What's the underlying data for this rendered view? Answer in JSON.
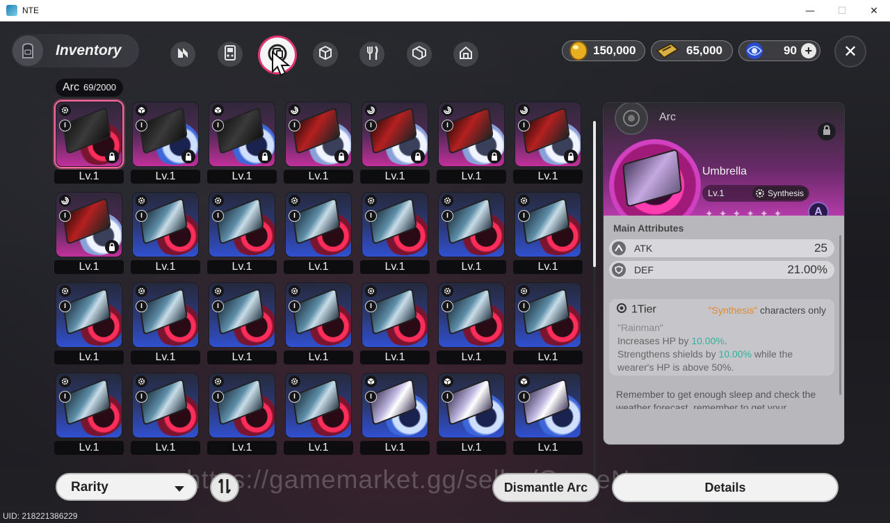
{
  "window": {
    "title": "NTE",
    "minimize_glyph": "—",
    "maximize_glyph": "☐",
    "close_glyph": "✕"
  },
  "header": {
    "title": "Inventory",
    "close_glyph": "✕",
    "categories": [
      {
        "icon": "n-logo-icon"
      },
      {
        "icon": "gameboy-icon"
      },
      {
        "icon": "arc-disc-icon",
        "active": true
      },
      {
        "icon": "cube-icon"
      },
      {
        "icon": "fork-knife-icon"
      },
      {
        "icon": "package-icon"
      },
      {
        "icon": "home-icon"
      }
    ],
    "currencies": [
      {
        "icon": "gold-egg-icon",
        "value": "150,000"
      },
      {
        "icon": "ticket-icon",
        "value": "65,000"
      },
      {
        "icon": "blue-orb-icon",
        "value": "90",
        "add_glyph": "+"
      }
    ]
  },
  "arc_count": {
    "label": "Arc",
    "count": "69/2000"
  },
  "grid": {
    "items": [
      {
        "type": "gear",
        "tier": "I",
        "color": "pink",
        "ring": "red",
        "disc": "dark",
        "locked": true,
        "selected": true,
        "level": "Lv.1"
      },
      {
        "type": "cube",
        "tier": "I",
        "color": "pink",
        "ring": "bluefx",
        "disc": "dark",
        "locked": true,
        "level": "Lv.1"
      },
      {
        "type": "cube",
        "tier": "I",
        "color": "pink",
        "ring": "bluefx",
        "disc": "dark",
        "locked": true,
        "level": "Lv.1"
      },
      {
        "type": "swirl",
        "tier": "I",
        "color": "pink",
        "ring": "white",
        "disc": "red",
        "locked": true,
        "level": "Lv.1"
      },
      {
        "type": "swirl",
        "tier": "I",
        "color": "pink",
        "ring": "white",
        "disc": "red",
        "locked": true,
        "level": "Lv.1"
      },
      {
        "type": "swirl",
        "tier": "I",
        "color": "pink",
        "ring": "white",
        "disc": "red",
        "locked": true,
        "level": "Lv.1"
      },
      {
        "type": "swirl",
        "tier": "I",
        "color": "pink",
        "ring": "white",
        "disc": "red",
        "locked": true,
        "level": "Lv.1"
      },
      {
        "type": "swirl",
        "tier": "I",
        "color": "pink",
        "ring": "white",
        "disc": "red",
        "locked": true,
        "level": "Lv.1"
      },
      {
        "type": "gear",
        "tier": "I",
        "color": "blue",
        "ring": "red",
        "disc": "ice",
        "locked": false,
        "level": "Lv.1"
      },
      {
        "type": "gear",
        "tier": "I",
        "color": "blue",
        "ring": "red",
        "disc": "ice",
        "locked": false,
        "level": "Lv.1"
      },
      {
        "type": "gear",
        "tier": "I",
        "color": "blue",
        "ring": "red",
        "disc": "ice",
        "locked": false,
        "level": "Lv.1"
      },
      {
        "type": "gear",
        "tier": "I",
        "color": "blue",
        "ring": "red",
        "disc": "ice",
        "locked": false,
        "level": "Lv.1"
      },
      {
        "type": "gear",
        "tier": "I",
        "color": "blue",
        "ring": "red",
        "disc": "ice",
        "locked": false,
        "level": "Lv.1"
      },
      {
        "type": "gear",
        "tier": "I",
        "color": "blue",
        "ring": "red",
        "disc": "ice",
        "locked": false,
        "level": "Lv.1"
      },
      {
        "type": "gear",
        "tier": "I",
        "color": "blue",
        "ring": "red",
        "disc": "ice",
        "locked": false,
        "level": "Lv.1"
      },
      {
        "type": "gear",
        "tier": "I",
        "color": "blue",
        "ring": "red",
        "disc": "ice",
        "locked": false,
        "level": "Lv.1"
      },
      {
        "type": "gear",
        "tier": "I",
        "color": "blue",
        "ring": "red",
        "disc": "ice",
        "locked": false,
        "level": "Lv.1"
      },
      {
        "type": "gear",
        "tier": "I",
        "color": "blue",
        "ring": "red",
        "disc": "ice",
        "locked": false,
        "level": "Lv.1"
      },
      {
        "type": "gear",
        "tier": "I",
        "color": "blue",
        "ring": "red",
        "disc": "ice",
        "locked": false,
        "level": "Lv.1"
      },
      {
        "type": "gear",
        "tier": "I",
        "color": "blue",
        "ring": "red",
        "disc": "ice",
        "locked": false,
        "level": "Lv.1"
      },
      {
        "type": "gear",
        "tier": "I",
        "color": "blue",
        "ring": "red",
        "disc": "ice",
        "locked": false,
        "level": "Lv.1"
      },
      {
        "type": "gear",
        "tier": "I",
        "color": "blue",
        "ring": "red",
        "disc": "ice",
        "locked": false,
        "level": "Lv.1"
      },
      {
        "type": "gear",
        "tier": "I",
        "color": "blue",
        "ring": "red",
        "disc": "ice",
        "locked": false,
        "level": "Lv.1"
      },
      {
        "type": "gear",
        "tier": "I",
        "color": "blue",
        "ring": "red",
        "disc": "ice",
        "locked": false,
        "level": "Lv.1"
      },
      {
        "type": "gear",
        "tier": "I",
        "color": "blue",
        "ring": "red",
        "disc": "ice",
        "locked": false,
        "level": "Lv.1"
      },
      {
        "type": "cube",
        "tier": "I",
        "color": "blue",
        "ring": "bluefx",
        "disc": "lilac",
        "locked": false,
        "level": "Lv.1"
      },
      {
        "type": "cube",
        "tier": "I",
        "color": "blue",
        "ring": "bluefx",
        "disc": "lilac",
        "locked": false,
        "level": "Lv.1"
      },
      {
        "type": "cube",
        "tier": "I",
        "color": "blue",
        "ring": "bluefx",
        "disc": "lilac",
        "locked": false,
        "level": "Lv.1"
      }
    ]
  },
  "detail": {
    "category": "Arc",
    "name": "Umbrella",
    "level": "Lv.1",
    "attribute_type": "Synthesis",
    "stars": "✦✦✦✦✦✦",
    "rank_letter": "A",
    "main_attributes_title": "Main Attributes",
    "attributes": [
      {
        "icon": "atk-icon",
        "name": "ATK",
        "value": "25"
      },
      {
        "icon": "def-icon",
        "name": "DEF",
        "value": "21.00%"
      }
    ],
    "tier": {
      "label": "1Tier",
      "restriction_highlight": "\"Synthesis\"",
      "restriction_text": " characters only",
      "set_name": "\"Rainman\"",
      "line1_pre": "Increases HP by ",
      "line1_val": "10.00%",
      "line1_post": ".",
      "line2_pre": "Strengthens shields by ",
      "line2_val": "10.00%",
      "line2_post": " while the wearer's HP is above 50%."
    },
    "flavor": "Remember to get enough sleep and check the weather forecast, remember to get your"
  },
  "bottom": {
    "rarity_label": "Rarity",
    "watermark": "https://gamemarket.gg/seller/GameNews",
    "dismantle_label": "Dismantle Arc",
    "details_label": "Details",
    "uid": "UID: 218221386229"
  }
}
